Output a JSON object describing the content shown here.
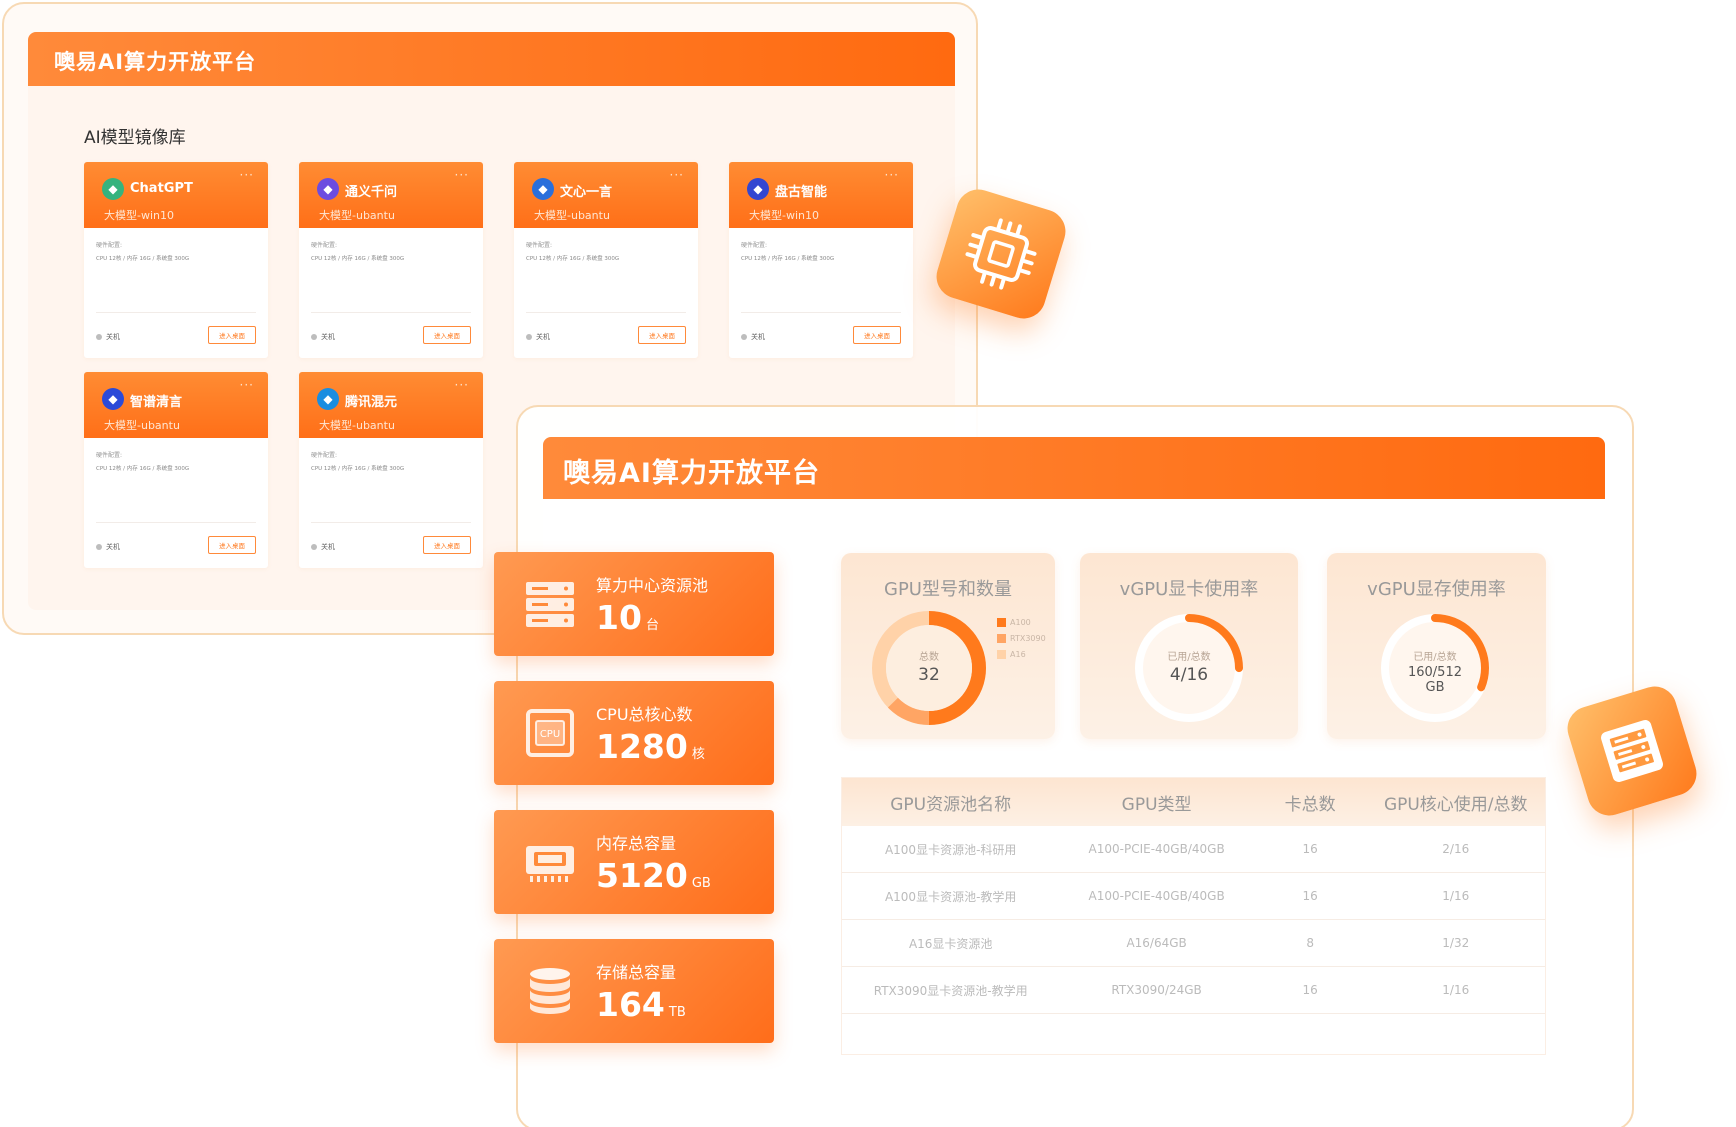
{
  "back_window": {
    "title": "噢易AI算力开放平台",
    "library_title": "AI模型镜像库",
    "spec_label": "硬件配置:",
    "spec_text": "CPU 12核 / 内存 16G / 系统盘 300G",
    "status_text": "关机",
    "enter_button": "进入桌面",
    "more": "···",
    "cards": [
      {
        "name": "ChatGPT",
        "sub": "大模型-win10",
        "color": "#35b37e"
      },
      {
        "name": "通义千问",
        "sub": "大模型-ubantu",
        "color": "#6c4ce0"
      },
      {
        "name": "文心一言",
        "sub": "大模型-ubantu",
        "color": "#2a6fdb"
      },
      {
        "name": "盘古智能",
        "sub": "大模型-win10",
        "color": "#3346d1"
      },
      {
        "name": "智谱清言",
        "sub": "大模型-ubantu",
        "color": "#2b4ad8"
      },
      {
        "name": "腾讯混元",
        "sub": "大模型-ubantu",
        "color": "#1a8de0"
      }
    ]
  },
  "front_window": {
    "title": "噢易AI算力开放平台"
  },
  "stats": [
    {
      "label": "算力中心资源池",
      "value": "10",
      "unit": "台",
      "icon": "server-rack-icon"
    },
    {
      "label": "CPU总核心数",
      "value": "1280",
      "unit": "核",
      "icon": "cpu-icon"
    },
    {
      "label": "内存总容量",
      "value": "5120",
      "unit": "GB",
      "icon": "memory-icon"
    },
    {
      "label": "存储总容量",
      "value": "164",
      "unit": "TB",
      "icon": "database-icon"
    }
  ],
  "gauges": [
    {
      "title": "GPU型号和数量",
      "center_label": "总数",
      "center_value": "32",
      "legend": [
        "A100",
        "RTX3090",
        "A16"
      ]
    },
    {
      "title": "vGPU显卡使用率",
      "center_label": "已用/总数",
      "center_value": "4/16",
      "fraction": 0.25
    },
    {
      "title": "vGPU显存使用率",
      "center_label": "已用/总数",
      "center_value": "160/512",
      "center_unit": "GB",
      "fraction": 0.3125
    }
  ],
  "table": {
    "headers": [
      "GPU资源池名称",
      "GPU类型",
      "卡总数",
      "GPU核心使用/总数"
    ],
    "rows": [
      [
        "A100显卡资源池-科研用",
        "A100-PCIE-40GB/40GB",
        "16",
        "2/16"
      ],
      [
        "A100显卡资源池-教学用",
        "A100-PCIE-40GB/40GB",
        "16",
        "1/16"
      ],
      [
        "A16显卡资源池",
        "A16/64GB",
        "8",
        "1/32"
      ],
      [
        "RTX3090显卡资源池-教学用",
        "RTX3090/24GB",
        "16",
        "1/16"
      ]
    ]
  },
  "colors": {
    "accent": "#ff7a20",
    "accent_dark": "#ff6a10",
    "legend_a100": "#ff7a1c",
    "legend_rtx3090": "#ffa564",
    "legend_a16": "#ffd2a8"
  }
}
